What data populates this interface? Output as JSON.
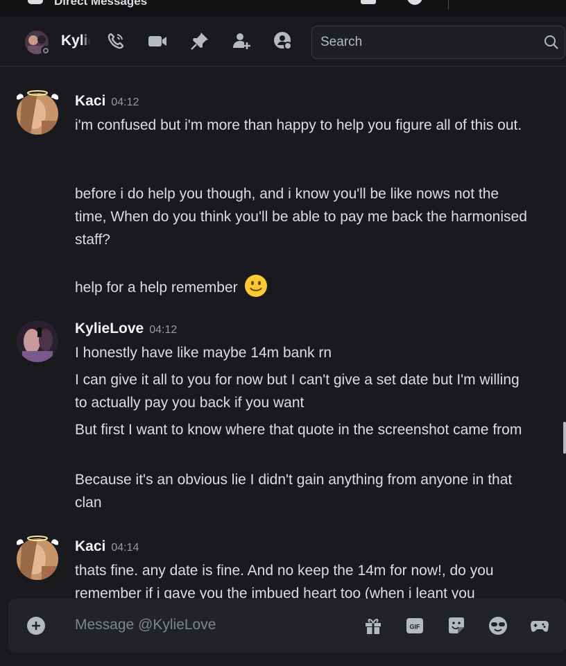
{
  "window": {
    "title": "Direct Messages"
  },
  "header": {
    "username": "Kylie",
    "status": "offline",
    "search_placeholder": "Search",
    "icons": [
      "phone-call-icon",
      "video-camera-icon",
      "pin-icon",
      "add-member-icon",
      "user-profile-icon"
    ]
  },
  "messages": [
    {
      "author": "Kaci",
      "time": "04:12",
      "lines": [
        "i'm confused but i'm more than happy to help you figure all of this out.",
        "",
        "before i do help you though, and i know you'll be like nows not the time,  When do you think you'll be able to pay me back the harmonised staff?",
        "",
        "help for a help remember"
      ],
      "emoji": "slightly-smiling-face"
    },
    {
      "author": "KylieLove",
      "time": "04:12",
      "lines": [
        "I honestly have like maybe 14m bank rn",
        "I can give it all to you for now but I can't give a set date but I'm willing to actually pay you back if you want",
        "But first I want to know where that quote in the screenshot came from",
        "Because it's an obvious lie I didn't gain anything from anyone in that clan"
      ]
    },
    {
      "author": "Kaci",
      "time": "04:14",
      "lines": [
        "thats fine. any date is fine. And no keep the 14m for now!, do you remember if i gave you the imbued heart too (when i leant you"
      ]
    }
  ],
  "composer": {
    "placeholder": "Message @KylieLove",
    "icons": [
      "gift-icon",
      "gif-icon",
      "sticker-icon",
      "emoji-icon",
      "activity-icon"
    ]
  },
  "colors": {
    "background": "#1a1a1e",
    "text": "#dbdee1",
    "muted": "#949ba4",
    "composer_bg": "#222327"
  }
}
